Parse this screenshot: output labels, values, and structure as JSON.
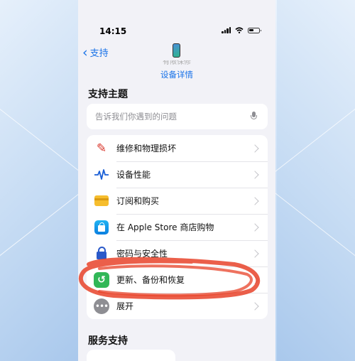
{
  "status_bar": {
    "time": "14:15"
  },
  "nav": {
    "back_label": "支持"
  },
  "device": {
    "cut_text": "有限保修",
    "detail_link": "设备详情"
  },
  "support_topics": {
    "title": "支持主题",
    "search_placeholder": "告诉我们你遇到的问题",
    "items": [
      {
        "label": "维修和物理损坏",
        "icon": "wrench-screwdriver-icon"
      },
      {
        "label": "设备性能",
        "icon": "waveform-icon"
      },
      {
        "label": "订阅和购买",
        "icon": "credit-card-icon"
      },
      {
        "label": "在 Apple Store 商店购物",
        "icon": "shopping-bag-icon"
      },
      {
        "label": "密码与安全性",
        "icon": "lock-icon"
      },
      {
        "label": "更新、备份和恢复",
        "icon": "restore-icon"
      },
      {
        "label": "展开",
        "icon": "more-icon"
      }
    ]
  },
  "services": {
    "title": "服务支持"
  },
  "colors": {
    "accent": "#1a73e8",
    "annotation": "#e8432a",
    "restore_green": "#31b757"
  }
}
